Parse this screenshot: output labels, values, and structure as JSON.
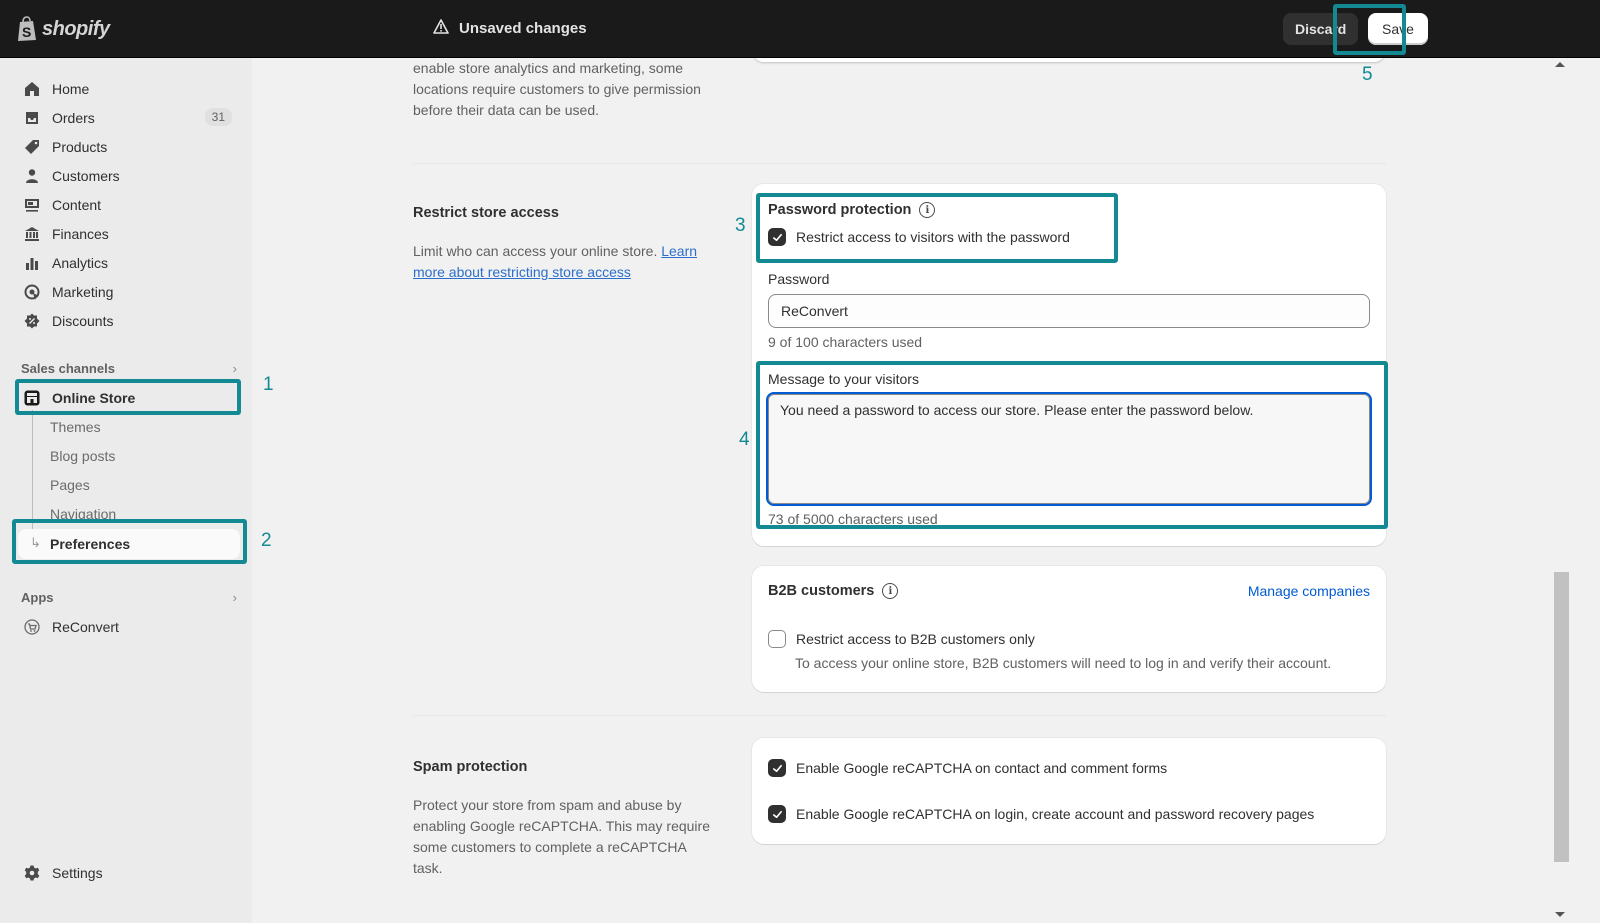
{
  "topbar": {
    "brand": "shopify",
    "status": "Unsaved changes",
    "discard_label": "Discard",
    "save_label": "Save"
  },
  "sidebar": {
    "items": [
      {
        "label": "Home",
        "icon": "home-icon"
      },
      {
        "label": "Orders",
        "icon": "orders-icon",
        "badge": "31"
      },
      {
        "label": "Products",
        "icon": "tag-icon"
      },
      {
        "label": "Customers",
        "icon": "person-icon"
      },
      {
        "label": "Content",
        "icon": "content-icon"
      },
      {
        "label": "Finances",
        "icon": "bank-icon"
      },
      {
        "label": "Analytics",
        "icon": "bar-chart-icon"
      },
      {
        "label": "Marketing",
        "icon": "target-icon"
      },
      {
        "label": "Discounts",
        "icon": "discount-icon"
      }
    ],
    "sales_channels": {
      "heading": "Sales channels",
      "online_store": "Online Store",
      "sub_items": [
        "Themes",
        "Blog posts",
        "Pages",
        "Navigation"
      ],
      "active_sub_item": "Preferences"
    },
    "apps": {
      "heading": "Apps",
      "items": [
        "ReConvert"
      ]
    },
    "settings_label": "Settings"
  },
  "annotations": [
    "1",
    "2",
    "3",
    "4",
    "5"
  ],
  "main": {
    "prev_section_desc": "enable store analytics and marketing, some locations require customers to give permission before their data can be used.",
    "restrict": {
      "title": "Restrict store access",
      "desc": "Limit who can access your online store.",
      "link": "Learn more about restricting store access",
      "password_card": {
        "title": "Password protection",
        "checkbox_label": "Restrict access to visitors with the password",
        "checkbox_checked": true,
        "password_label": "Password",
        "password_value": "ReConvert",
        "password_help": "9 of 100 characters used",
        "message_label": "Message to your visitors",
        "message_value": "You need a password to access our store. Please enter the password below.",
        "message_help": "73 of 5000 characters used"
      },
      "b2b_card": {
        "title": "B2B customers",
        "manage_link": "Manage companies",
        "checkbox_label": "Restrict access to B2B customers only",
        "checkbox_checked": false,
        "desc": "To access your online store, B2B customers will need to log in and verify their account."
      }
    },
    "spam": {
      "title": "Spam protection",
      "desc": "Protect your store from spam and abuse by enabling Google reCAPTCHA. This may require some customers to complete a reCAPTCHA task.",
      "options": [
        {
          "label": "Enable Google reCAPTCHA on contact and comment forms",
          "checked": true
        },
        {
          "label": "Enable Google reCAPTCHA on login, create account and password recovery pages",
          "checked": true
        }
      ]
    }
  },
  "colors": {
    "annotation": "#138a93",
    "focus": "#005bd3",
    "link": "#2c6ecb"
  }
}
